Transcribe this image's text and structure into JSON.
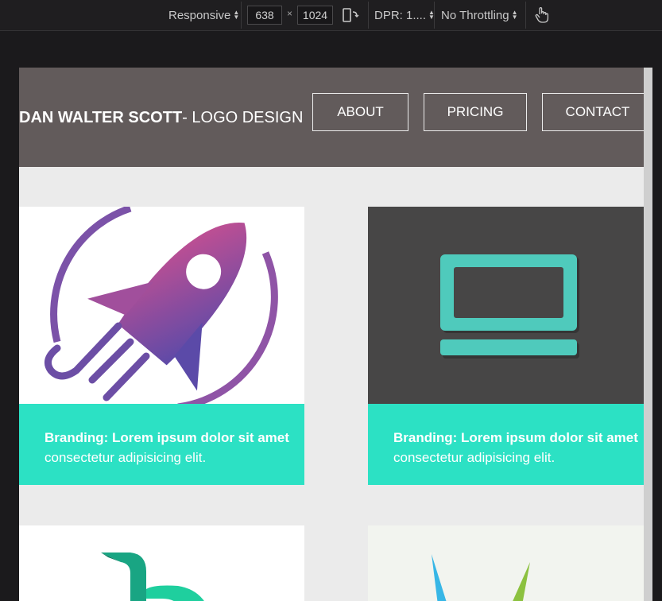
{
  "devtools": {
    "device_mode": "Responsive",
    "width_value": "638",
    "height_value": "1024",
    "times_symbol": "×",
    "dpr": "DPR: 1....",
    "throttling": "No Throttling"
  },
  "page": {
    "brand_bold": "DAN WALTER SCOTT",
    "brand_rest": "- LOGO DESIGN",
    "nav": [
      {
        "label": "ABOUT"
      },
      {
        "label": "PRICING"
      },
      {
        "label": "CONTACT"
      }
    ],
    "cards": [
      {
        "title": "Branding: Lorem ipsum dolor sit amet",
        "text": "consectetur adipisicing elit.",
        "image": "rocket-logo"
      },
      {
        "title": "Branding: Lorem ipsum dolor sit amet",
        "text": "consectetur adipisicing elit.",
        "image": "laptop-logo"
      },
      {
        "image": "green-b-logo"
      },
      {
        "image": "colorful-v-logo"
      }
    ],
    "colors": {
      "header_bg": "#625b5b",
      "caption_bg": "#2ce1c4",
      "page_bg": "#ebebeb",
      "laptop_accent": "#4fcabc"
    }
  }
}
